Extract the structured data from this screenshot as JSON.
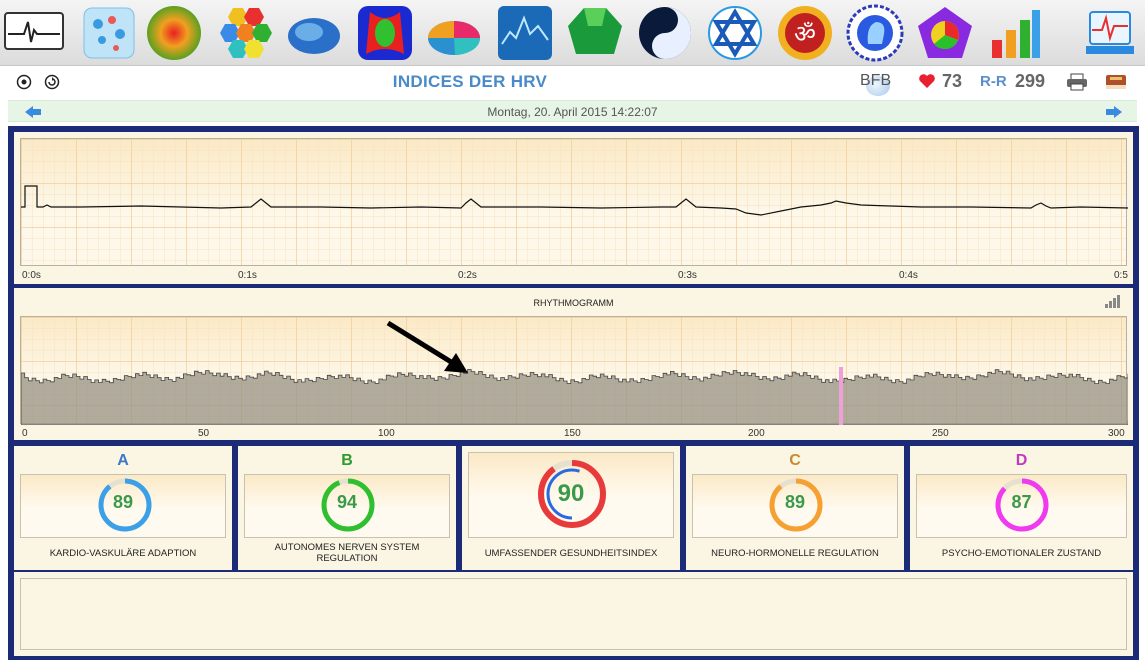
{
  "toolbar": {
    "icons": [
      "ecg-logo-icon",
      "cells-icon",
      "heat-sphere-icon",
      "hexagons-icon",
      "brain-icon",
      "body-scan-icon",
      "pie-chart-icon",
      "spectrum-icon",
      "emerald-icon",
      "yin-yang-icon",
      "star-of-david-icon",
      "om-icon",
      "head-icon",
      "pentagon-icon",
      "bar-chart-icon",
      "heartquest-logo-icon"
    ]
  },
  "header": {
    "title": "INDICES DER HRV",
    "bfb_label": "BFB",
    "heart_rate": "73",
    "rr_label": "R-R",
    "rr_value": "299"
  },
  "datebar": {
    "date": "Montag, 20. April 2015 14:22:07"
  },
  "ecg": {
    "ticks": [
      "0:0s",
      "0:1s",
      "0:2s",
      "0:3s",
      "0:4s",
      "0:5"
    ]
  },
  "rhythmogram": {
    "title": "RHYTHMOGRAMM",
    "ticks": [
      "0",
      "50",
      "100",
      "150",
      "200",
      "250",
      "300"
    ]
  },
  "indices": [
    {
      "letter": "A",
      "value": "89",
      "caption": "KARDIO-VASKULÄRE ADAPTION",
      "color": "#3aa0e8",
      "letter_color": "#3a7ac8",
      "fraction": 0.89
    },
    {
      "letter": "B",
      "value": "94",
      "caption": "AUTONOMES NERVEN SYSTEM REGULATION",
      "color": "#2ec02e",
      "letter_color": "#2e9a2e",
      "fraction": 0.94
    },
    {
      "letter": "",
      "value": "90",
      "caption": "UMFASSENDER GESUNDHEITSINDEX",
      "color": "#e83a3a",
      "letter_color": "#333333",
      "fraction": 0.9
    },
    {
      "letter": "C",
      "value": "89",
      "caption": "NEURO-HORMONELLE REGULATION",
      "color": "#f5a030",
      "letter_color": "#c88a2e",
      "fraction": 0.89
    },
    {
      "letter": "D",
      "value": "87",
      "caption": "PSYCHO-EMOTIONALER ZUSTAND",
      "color": "#f03af0",
      "letter_color": "#c03ac0",
      "fraction": 0.87
    }
  ]
}
